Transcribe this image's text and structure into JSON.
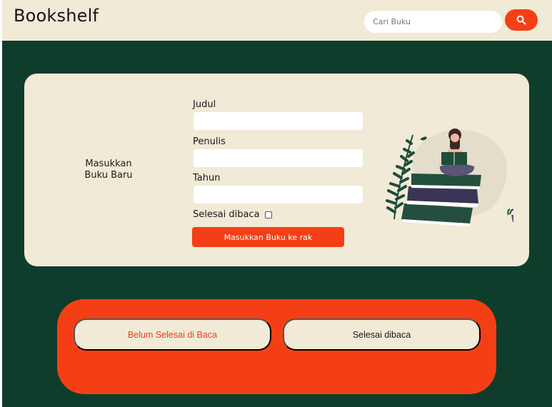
{
  "app": {
    "title": "Bookshelf"
  },
  "search": {
    "placeholder": "Cari Buku",
    "button_icon": "search-icon"
  },
  "form": {
    "intro_line1": "Masukkan",
    "intro_line2": "Buku Baru",
    "title_label": "Judul",
    "author_label": "Penulis",
    "year_label": "Tahun",
    "finished_label": "Selesai dibaca",
    "finished_checked": false,
    "submit_label": "Masukkan Buku ke rak",
    "illustration_icon": "reading-woman-on-books-illustration"
  },
  "shelves": {
    "unfinished_label": "Belum Selesai di Baca",
    "finished_label": "Selesai dibaca"
  },
  "colors": {
    "background": "#0f3d2b",
    "cream": "#f0ead6",
    "accent": "#f43f16",
    "unfinished_text": "#e8411a",
    "finished_text": "#1a1a1a"
  }
}
